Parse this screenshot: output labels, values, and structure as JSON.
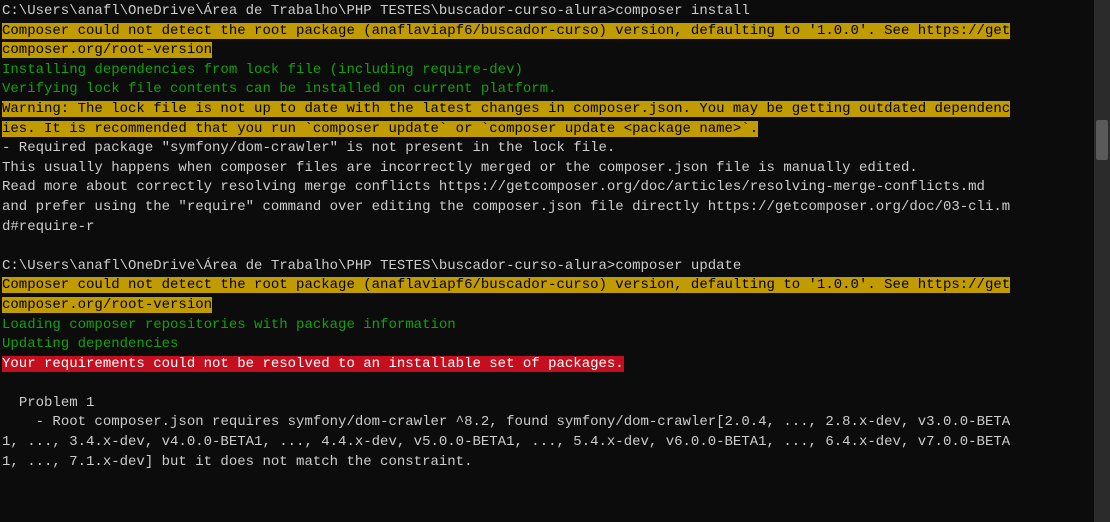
{
  "lines": [
    {
      "segments": [
        {
          "cls": "prompt",
          "text": "C:\\Users\\anafl\\OneDrive\\Área de Trabalho\\PHP TESTES\\buscador-curso-alura>"
        },
        {
          "cls": "cmd",
          "text": "composer install"
        }
      ]
    },
    {
      "segments": [
        {
          "cls": "hl-yellow",
          "text": "Composer could not detect the root package (anaflaviapf6/buscador-curso) version, defaulting to '1.0.0'. See https://get"
        }
      ]
    },
    {
      "segments": [
        {
          "cls": "hl-yellow",
          "text": "composer.org/root-version"
        }
      ]
    },
    {
      "segments": [
        {
          "cls": "green",
          "text": "Installing dependencies from lock file (including require-dev)"
        }
      ]
    },
    {
      "segments": [
        {
          "cls": "green",
          "text": "Verifying lock file contents can be installed on current platform."
        }
      ]
    },
    {
      "segments": [
        {
          "cls": "hl-yellow",
          "text": "Warning: The lock file is not up to date with the latest changes in composer.json. You may be getting outdated dependenc"
        }
      ]
    },
    {
      "segments": [
        {
          "cls": "hl-yellow",
          "text": "ies. It is recommended that you run `composer update` or `composer update <package name>`."
        }
      ]
    },
    {
      "segments": [
        {
          "cls": "white",
          "text": "- Required package \"symfony/dom-crawler\" is not present in the lock file."
        }
      ]
    },
    {
      "segments": [
        {
          "cls": "white",
          "text": "This usually happens when composer files are incorrectly merged or the composer.json file is manually edited."
        }
      ]
    },
    {
      "segments": [
        {
          "cls": "white",
          "text": "Read more about correctly resolving merge conflicts https://getcomposer.org/doc/articles/resolving-merge-conflicts.md"
        }
      ]
    },
    {
      "segments": [
        {
          "cls": "white",
          "text": "and prefer using the \"require\" command over editing the composer.json file directly https://getcomposer.org/doc/03-cli.m"
        }
      ]
    },
    {
      "segments": [
        {
          "cls": "white",
          "text": "d#require-r"
        }
      ]
    },
    {
      "segments": [
        {
          "cls": "white",
          "text": " "
        }
      ]
    },
    {
      "segments": [
        {
          "cls": "prompt",
          "text": "C:\\Users\\anafl\\OneDrive\\Área de Trabalho\\PHP TESTES\\buscador-curso-alura>"
        },
        {
          "cls": "cmd",
          "text": "composer update"
        }
      ]
    },
    {
      "segments": [
        {
          "cls": "hl-yellow",
          "text": "Composer could not detect the root package (anaflaviapf6/buscador-curso) version, defaulting to '1.0.0'. See https://get"
        }
      ]
    },
    {
      "segments": [
        {
          "cls": "hl-yellow",
          "text": "composer.org/root-version"
        }
      ]
    },
    {
      "segments": [
        {
          "cls": "green",
          "text": "Loading composer repositories with package information"
        }
      ]
    },
    {
      "segments": [
        {
          "cls": "green",
          "text": "Updating dependencies"
        }
      ]
    },
    {
      "segments": [
        {
          "cls": "hl-red",
          "text": "Your requirements could not be resolved to an installable set of packages."
        }
      ]
    },
    {
      "segments": [
        {
          "cls": "white",
          "text": " "
        }
      ]
    },
    {
      "segments": [
        {
          "cls": "white",
          "text": "  Problem 1"
        }
      ]
    },
    {
      "segments": [
        {
          "cls": "white",
          "text": "    - Root composer.json requires symfony/dom-crawler ^8.2, found symfony/dom-crawler[2.0.4, ..., 2.8.x-dev, v3.0.0-BETA"
        }
      ]
    },
    {
      "segments": [
        {
          "cls": "white",
          "text": "1, ..., 3.4.x-dev, v4.0.0-BETA1, ..., 4.4.x-dev, v5.0.0-BETA1, ..., 5.4.x-dev, v6.0.0-BETA1, ..., 6.4.x-dev, v7.0.0-BETA"
        }
      ]
    },
    {
      "segments": [
        {
          "cls": "white",
          "text": "1, ..., 7.1.x-dev] but it does not match the constraint."
        }
      ]
    }
  ]
}
